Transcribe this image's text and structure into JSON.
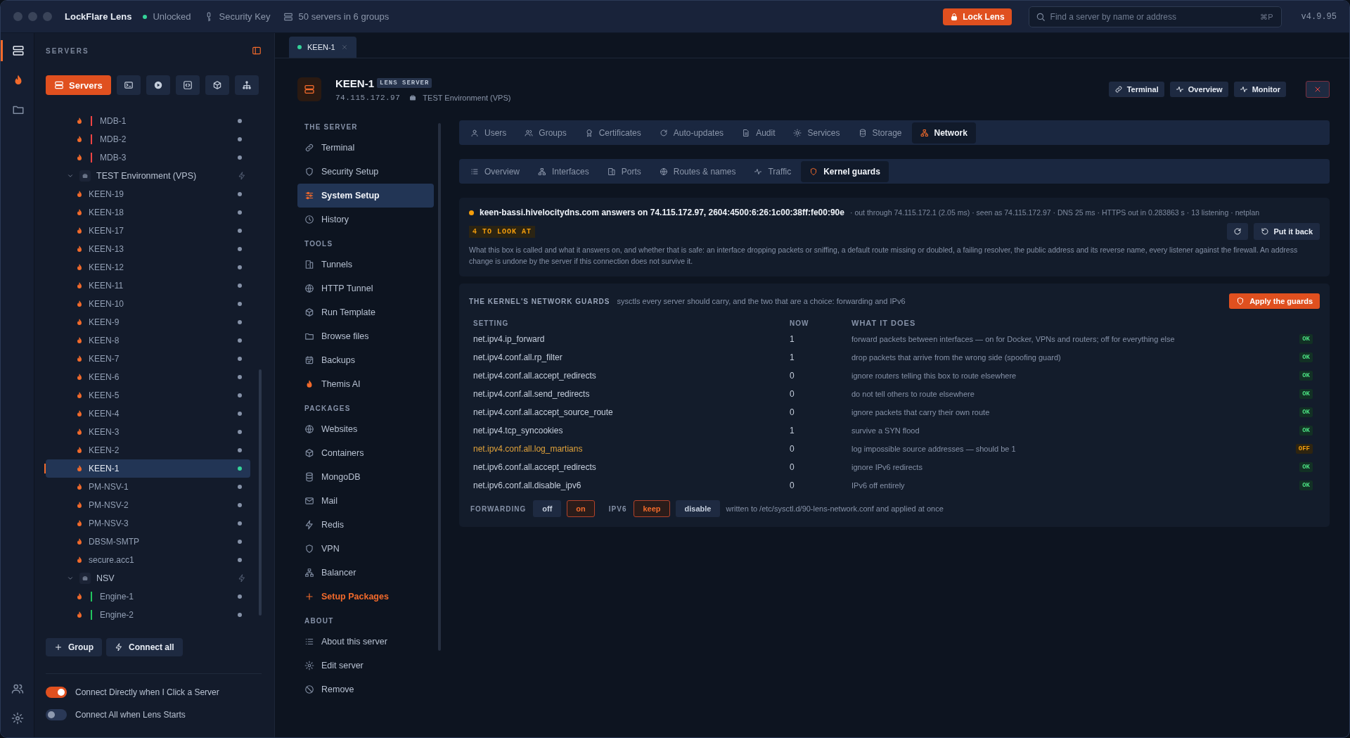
{
  "titlebar": {
    "app": "LockFlare Lens",
    "lock_state": "Unlocked",
    "key": "Security Key",
    "servers": "50 servers in 6 groups",
    "lock_button": "Lock Lens",
    "search": {
      "placeholder": "Find a server by name or address"
    },
    "shortcut": "⌘P",
    "version": "v4.9.95"
  },
  "rail": [
    {
      "selected": true
    },
    {
      "selected": false
    },
    {
      "selected": false
    }
  ],
  "sidebar": {
    "title": "SERVERS",
    "mode_tabs": [
      {
        "label": "Servers",
        "selected": true
      },
      {
        "selected": false
      },
      {
        "selected": false
      },
      {
        "selected": false
      },
      {
        "selected": false
      },
      {
        "selected": false
      }
    ],
    "tree": [
      {
        "children": [
          {
            "name": "MDB-1",
            "color": "#ef4444",
            "selected": false,
            "connected": false
          },
          {
            "name": "MDB-2",
            "color": "#ef4444",
            "selected": false,
            "connected": false
          },
          {
            "name": "MDB-3",
            "color": "#ef4444",
            "selected": false,
            "connected": false
          }
        ]
      },
      {
        "name": "TEST Environment (VPS)",
        "expanded": true,
        "children": [
          {
            "name": "KEEN-19",
            "selected": false,
            "connected": false
          },
          {
            "name": "KEEN-18",
            "selected": false,
            "connected": false
          },
          {
            "name": "KEEN-17",
            "selected": false,
            "connected": false
          },
          {
            "name": "KEEN-13",
            "selected": false,
            "connected": false
          },
          {
            "name": "KEEN-12",
            "selected": false,
            "connected": false
          },
          {
            "name": "KEEN-11",
            "selected": false,
            "connected": false
          },
          {
            "name": "KEEN-10",
            "selected": false,
            "connected": false
          },
          {
            "name": "KEEN-9",
            "selected": false,
            "connected": false
          },
          {
            "name": "KEEN-8",
            "selected": false,
            "connected": false
          },
          {
            "name": "KEEN-7",
            "selected": false,
            "connected": false
          },
          {
            "name": "KEEN-6",
            "selected": false,
            "connected": false
          },
          {
            "name": "KEEN-5",
            "selected": false,
            "connected": false
          },
          {
            "name": "KEEN-4",
            "selected": false,
            "connected": false
          },
          {
            "name": "KEEN-3",
            "selected": false,
            "connected": false
          },
          {
            "name": "KEEN-2",
            "selected": false,
            "connected": false
          },
          {
            "name": "KEEN-1",
            "selected": true,
            "connected": true
          },
          {
            "name": "PM-NSV-1",
            "selected": false,
            "connected": false
          },
          {
            "name": "PM-NSV-2",
            "selected": false,
            "connected": false
          },
          {
            "name": "PM-NSV-3",
            "selected": false,
            "connected": false
          },
          {
            "name": "DBSM-SMTP",
            "selected": false,
            "connected": false
          },
          {
            "name": "secure.acc1",
            "selected": false,
            "connected": false
          }
        ]
      },
      {
        "name": "NSV",
        "expanded": true,
        "children": [
          {
            "name": "Engine-1",
            "color": "#22c55e",
            "selected": false,
            "connected": false
          },
          {
            "name": "Engine-2",
            "color": "#22c55e",
            "selected": false,
            "connected": false
          }
        ]
      }
    ],
    "buttons": [
      "Group",
      "Connect all"
    ],
    "toggles": [
      {
        "label": "Connect Directly when I Click a Server",
        "on": true
      },
      {
        "label": "Connect All when Lens Starts",
        "on": false
      }
    ]
  },
  "tabs": [
    {
      "label": "KEEN-1",
      "selected": true,
      "connected": true
    }
  ],
  "server": {
    "name": "KEEN-1",
    "badge": "LENS SERVER",
    "address": "74.115.172.97",
    "group": "TEST Environment (VPS)",
    "actions": [
      "Terminal",
      "Overview",
      "Monitor"
    ]
  },
  "nav": [
    {
      "heading": "THE SERVER",
      "items": [
        {
          "label": "Terminal",
          "selected": false
        },
        {
          "label": "Security Setup",
          "selected": false
        },
        {
          "label": "System Setup",
          "selected": true
        },
        {
          "label": "History",
          "selected": false
        }
      ]
    },
    {
      "heading": "TOOLS",
      "items": [
        {
          "label": "Tunnels",
          "selected": false
        },
        {
          "label": "HTTP Tunnel",
          "selected": false
        },
        {
          "label": "Run Template",
          "selected": false
        },
        {
          "label": "Browse files",
          "selected": false
        },
        {
          "label": "Backups",
          "selected": false
        },
        {
          "label": "Themis AI",
          "selected": false
        }
      ]
    },
    {
      "heading": "PACKAGES",
      "items": [
        {
          "label": "Websites",
          "selected": false,
          "kind": "link"
        },
        {
          "label": "Containers",
          "selected": false,
          "kind": "link"
        },
        {
          "label": "MongoDB",
          "selected": false,
          "kind": "link"
        },
        {
          "label": "Mail",
          "selected": false,
          "kind": "link"
        },
        {
          "label": "Redis",
          "selected": false,
          "kind": "link"
        },
        {
          "label": "VPN",
          "selected": false,
          "kind": "link"
        },
        {
          "label": "Balancer",
          "selected": false,
          "kind": "link"
        },
        {
          "label": "Setup Packages",
          "selected": false,
          "kind": "add"
        }
      ]
    },
    {
      "heading": "ABOUT",
      "items": [
        {
          "label": "About this server",
          "selected": false
        },
        {
          "label": "Edit server",
          "selected": false
        },
        {
          "label": "Remove",
          "selected": false
        }
      ]
    }
  ],
  "section_tabs": [
    {
      "label": "Users",
      "selected": false
    },
    {
      "label": "Groups",
      "selected": false
    },
    {
      "label": "Certificates",
      "selected": false
    },
    {
      "label": "Auto-updates",
      "selected": false
    },
    {
      "label": "Audit",
      "selected": false
    },
    {
      "label": "Services",
      "selected": false
    },
    {
      "label": "Storage",
      "selected": false
    },
    {
      "label": "Network",
      "selected": true
    }
  ],
  "network_tabs": [
    {
      "label": "Overview",
      "selected": false
    },
    {
      "label": "Interfaces",
      "selected": false
    },
    {
      "label": "Ports",
      "selected": false
    },
    {
      "label": "Routes & names",
      "selected": false
    },
    {
      "label": "Traffic",
      "selected": false
    },
    {
      "label": "Kernel guards",
      "selected": true
    }
  ],
  "status": {
    "host_line": "keen-bassi.hivelocitydns.com answers on 74.115.172.97, 2604:4500:6:26:1c00:38ff:fe00:90e",
    "details": "· out through 74.115.172.1 (2.05 ms) · seen as 74.115.172.97 · DNS 25 ms · HTTPS out in 0.283863 s · 13 listening · netplan",
    "flag": "4 TO LOOK AT",
    "button": "Put it back",
    "note": "What this box is called and what it answers on, and whether that is safe: an interface dropping packets or sniffing, a default route missing or doubled, a failing resolver, the public address and its reverse name, every listener against the firewall. An address change is undone by the server if this connection does not survive it."
  },
  "guards": {
    "title": "THE KERNEL'S NETWORK GUARDS",
    "subtitle": "sysctls every server should carry, and the two that are a choice: forwarding and IPv6",
    "apply": "Apply the guards",
    "columns": [
      "SETTING",
      "NOW",
      "WHAT IT DOES"
    ],
    "rows": [
      {
        "setting": "net.ipv4.ip_forward",
        "now": "1",
        "does": "forward packets between interfaces — on for Docker, VPNs and routers; off for everything else",
        "status": "OK",
        "ok": true
      },
      {
        "setting": "net.ipv4.conf.all.rp_filter",
        "now": "1",
        "does": "drop packets that arrive from the wrong side (spoofing guard)",
        "status": "OK",
        "ok": true
      },
      {
        "setting": "net.ipv4.conf.all.accept_redirects",
        "now": "0",
        "does": "ignore routers telling this box to route elsewhere",
        "status": "OK",
        "ok": true
      },
      {
        "setting": "net.ipv4.conf.all.send_redirects",
        "now": "0",
        "does": "do not tell others to route elsewhere",
        "status": "OK",
        "ok": true
      },
      {
        "setting": "net.ipv4.conf.all.accept_source_route",
        "now": "0",
        "does": "ignore packets that carry their own route",
        "status": "OK",
        "ok": true
      },
      {
        "setting": "net.ipv4.tcp_syncookies",
        "now": "1",
        "does": "survive a SYN flood",
        "status": "OK",
        "ok": true
      },
      {
        "setting": "net.ipv4.conf.all.log_martians",
        "now": "0",
        "does": "log impossible source addresses — should be 1",
        "status": "OFF",
        "ok": false
      },
      {
        "setting": "net.ipv6.conf.all.accept_redirects",
        "now": "0",
        "does": "ignore IPv6 redirects",
        "status": "OK",
        "ok": true
      },
      {
        "setting": "net.ipv6.conf.all.disable_ipv6",
        "now": "0",
        "does": "IPv6 off entirely",
        "status": "OK",
        "ok": true
      }
    ],
    "choices": [
      {
        "label": "FORWARDING",
        "options": [
          {
            "label": "off",
            "selected": false
          },
          {
            "label": "on",
            "selected": true
          }
        ]
      },
      {
        "label": "IPV6",
        "options": [
          {
            "label": "keep",
            "selected": true
          },
          {
            "label": "disable",
            "selected": false
          }
        ]
      }
    ],
    "footnote": "written to /etc/sysctl.d/90-lens-network.conf and applied at once"
  }
}
